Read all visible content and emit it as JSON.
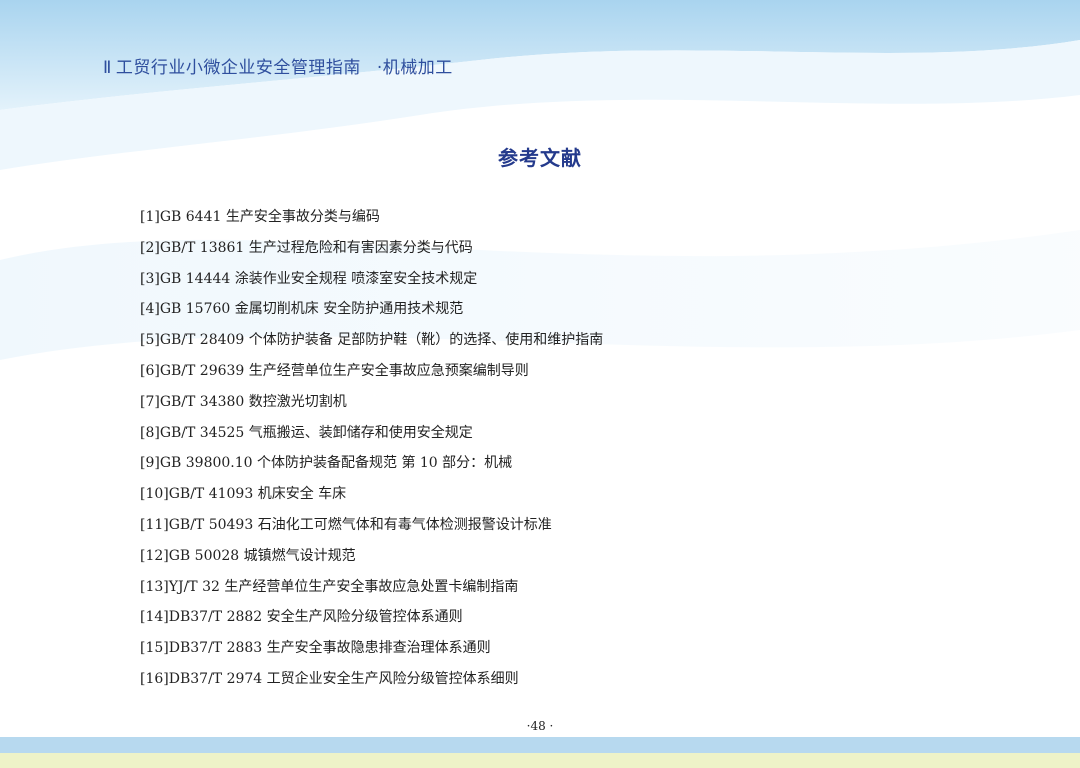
{
  "header": {
    "mark": "Ⅱ",
    "title": "工贸行业小微企业安全管理指南",
    "subtitle": "·机械加工"
  },
  "section_title": "参考文献",
  "references": [
    "[1]GB 6441 生产安全事故分类与编码",
    "[2]GB/T 13861 生产过程危险和有害因素分类与代码",
    "[3]GB 14444 涂装作业安全规程 喷漆室安全技术规定",
    "[4]GB 15760 金属切削机床 安全防护通用技术规范",
    "[5]GB/T 28409 个体防护装备 足部防护鞋（靴）的选择、使用和维护指南",
    "[6]GB/T 29639 生产经营单位生产安全事故应急预案编制导则",
    "[7]GB/T 34380 数控激光切割机",
    "[8]GB/T 34525 气瓶搬运、装卸储存和使用安全规定",
    "[9]GB 39800.10 个体防护装备配备规范 第 10 部分：机械",
    "[10]GB/T 41093 机床安全 车床",
    "[11]GB/T 50493 石油化工可燃气体和有毒气体检测报警设计标准",
    "[12]GB 50028 城镇燃气设计规范",
    "[13]YJ/T 32 生产经营单位生产安全事故应急处置卡编制指南",
    "[14]DB37/T 2882 安全生产风险分级管控体系通则",
    "[15]DB37/T 2883 生产安全事故隐患排查治理体系通则",
    "[16]DB37/T 2974 工贸企业安全生产风险分级管控体系细则"
  ],
  "page_number": "·48 ·",
  "colors": {
    "header_text": "#2f4f9e",
    "title_text": "#243a8c",
    "body_text": "#222222",
    "wave_light": "#dceffa",
    "wave_mid": "#a9d4ef",
    "footer_blue": "#b7d9ef",
    "footer_yellow": "#eef3c8"
  }
}
